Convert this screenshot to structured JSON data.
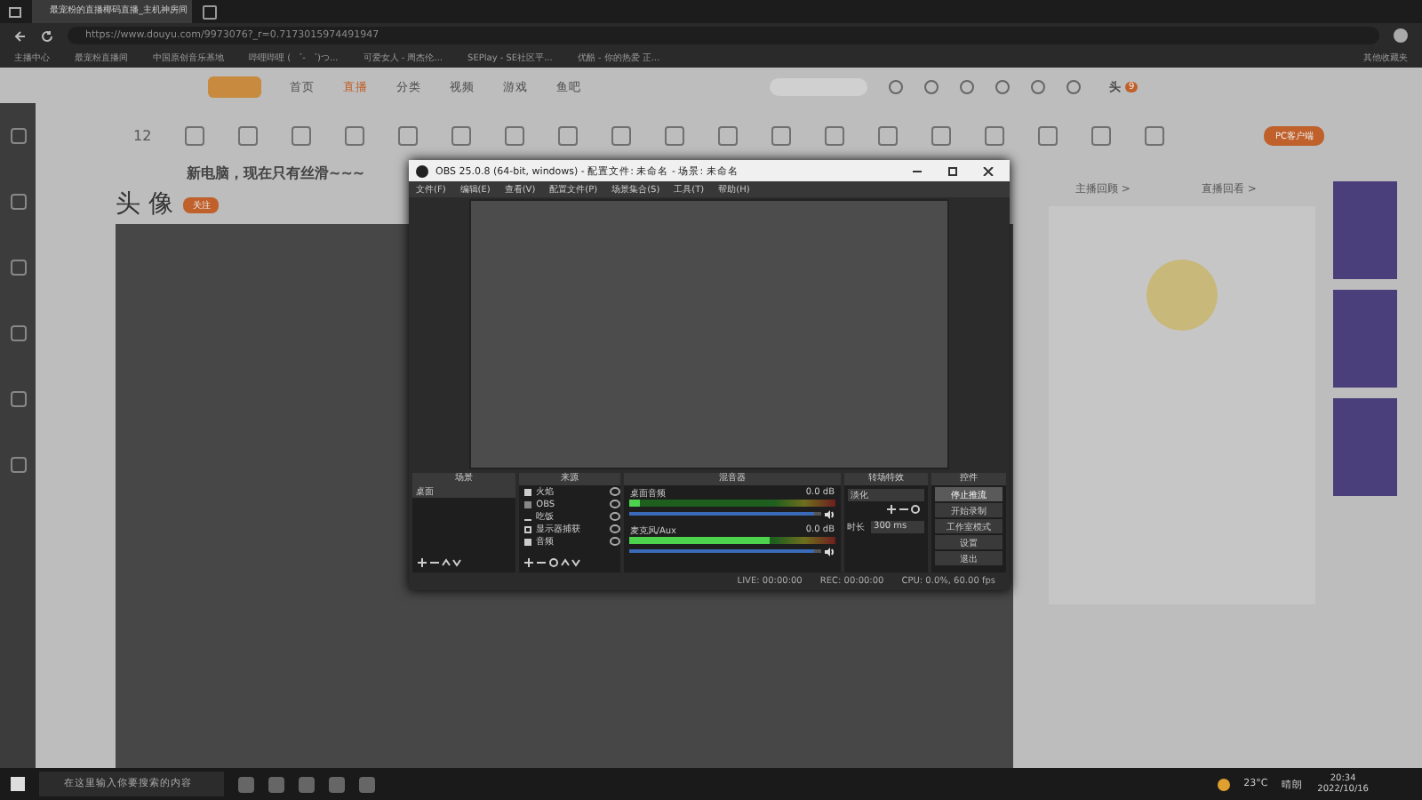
{
  "browser": {
    "tab": {
      "title": "最宠粉的直播椰码直播_主机神房间",
      "selected": true
    },
    "url": "https://www.douyu.com/9973076?_r=0.7173015974491947",
    "bookmarks": [
      "主播中心",
      "最宠粉直播间",
      "中国原创音乐基地",
      "哔哩哔哩 ( ゜- ゜)つ...",
      "可爱女人 - 周杰伦...",
      "SEPlay - SE社区平...",
      "优酷 - 你的热爱 正..."
    ],
    "favorites": "其他收藏夹"
  },
  "site": {
    "nav": [
      {
        "label": "首页",
        "selected": false
      },
      {
        "label": "直播",
        "selected": true
      },
      {
        "label": "分类",
        "selected": false
      },
      {
        "label": "视频",
        "selected": false
      },
      {
        "label": "游戏",
        "selected": false
      },
      {
        "label": "鱼吧",
        "selected": false
      }
    ],
    "user": "头",
    "notice_count": "9",
    "follow_count": "12",
    "pc_button": "PC客户端",
    "stream_title": "新电脑，现在只有丝滑~~~",
    "streamer_name": "头 像",
    "follow_button": "关注",
    "links": [
      "主播回顾 >",
      "直播回看 >"
    ]
  },
  "obs": {
    "title": "OBS 25.0.8 (64-bit, windows) - 配置文件: 未命名 - 场景: 未命名",
    "menu": [
      "文件(F)",
      "编辑(E)",
      "查看(V)",
      "配置文件(P)",
      "场景集合(S)",
      "工具(T)",
      "帮助(H)"
    ],
    "panels": [
      "场景",
      "来源",
      "混音器",
      "转场特效",
      "控件"
    ],
    "scenes": [
      {
        "name": "桌面",
        "selected": true
      }
    ],
    "sources": [
      {
        "name": "火焰",
        "kind": "image"
      },
      {
        "name": "OBS",
        "kind": "window"
      },
      {
        "name": "吃饭",
        "kind": "text"
      },
      {
        "name": "显示器捕获",
        "kind": "display"
      },
      {
        "name": "音频",
        "kind": "image"
      }
    ],
    "mixer": [
      {
        "name": "桌面音频",
        "reading": "0.0 dB",
        "level": 0.05,
        "volume": {
          "level": 0.97
        }
      },
      {
        "name": "麦克风/Aux",
        "reading": "0.0 dB",
        "level": 0.68,
        "volume": {
          "level": 0.97
        }
      }
    ],
    "transition": {
      "type": "淡化",
      "duration_label": "时长",
      "duration": "300 ms"
    },
    "controls": [
      {
        "label": "停止推流",
        "selected": true
      },
      {
        "label": "开始录制",
        "selected": false
      },
      {
        "label": "工作室模式",
        "selected": false
      },
      {
        "label": "设置",
        "selected": false
      },
      {
        "label": "退出",
        "selected": false
      }
    ],
    "status": {
      "live": "LIVE: 00:00:00",
      "rec": "REC: 00:00:00",
      "cpu": "CPU: 0.0%, 60.00 fps"
    }
  },
  "taskbar": {
    "search_placeholder": "在这里输入你要搜索的内容",
    "temperature": "23°C",
    "weather": "晴朗",
    "time": "20:34",
    "date": "2022/10/16"
  }
}
